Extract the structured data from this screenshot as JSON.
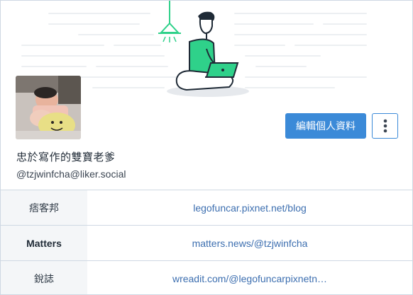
{
  "profile": {
    "display_name": "忠於寫作的雙寶老爹",
    "handle": "@tzjwinfcha@liker.social",
    "edit_button_label": "編輯個人資料",
    "more_icon": "vertical-ellipsis-icon"
  },
  "links": [
    {
      "label": "痞客邦",
      "url_text": "legofuncar.pixnet.net/blog"
    },
    {
      "label": "Matters",
      "url_text": "matters.news/@tzjwinfcha"
    },
    {
      "label": "銳誌",
      "url_text": "wreadit.com/@legofuncarpixnetn…"
    }
  ],
  "colors": {
    "accent": "#3b8ad8",
    "link": "#3d6fb0",
    "illustration_green": "#2fd18a",
    "border": "#cfd8e3"
  }
}
